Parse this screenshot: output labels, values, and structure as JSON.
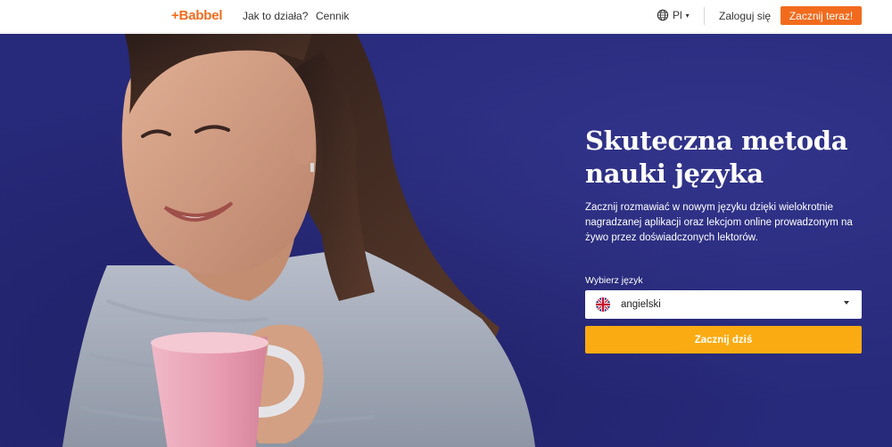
{
  "nav": {
    "logo": "+Babbel",
    "links": [
      "Jak to działa?",
      "Cennik"
    ],
    "language": "Pl",
    "login": "Zaloguj się",
    "cta": "Zacznij teraz!"
  },
  "hero": {
    "headline_line1": "Skuteczna metoda",
    "headline_line2": "nauki języka",
    "description": "Zacznij rozmawiać w nowym języku dzięki wielokrotnie nagradzanej aplikacji oraz lekcjom online prowadzonym na żywo przez doświadczonych lektorów.",
    "select_label": "Wybierz język",
    "selected_language": "angielski",
    "cta": "Zacznij dziś"
  },
  "icons": {
    "globe": "globe-icon",
    "flag": "uk-flag-icon",
    "caret": "chevron-down-icon"
  },
  "colors": {
    "brand_orange": "#f26b1d",
    "cta_yellow": "#fbab12",
    "hero_background": "#27297a"
  }
}
